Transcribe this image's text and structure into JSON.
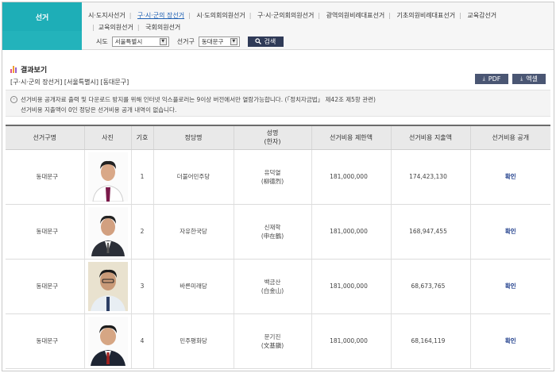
{
  "sidebar": {
    "label": "선거"
  },
  "tabs": [
    {
      "label": "시·도지사선거",
      "active": false
    },
    {
      "label": "구·시·군의 장선거",
      "active": true
    },
    {
      "label": "시·도의회의원선거",
      "active": false
    },
    {
      "label": "구·시·군의회의원선거",
      "active": false
    },
    {
      "label": "광역의원비례대표선거",
      "active": false
    },
    {
      "label": "기초의원비례대표선거",
      "active": false
    },
    {
      "label": "교육감선거",
      "active": false
    },
    {
      "label": "교육의원선거",
      "active": false
    },
    {
      "label": "국회의원선거",
      "active": false
    }
  ],
  "filter": {
    "sido_label": "시도",
    "sido_value": "서울특별시",
    "district_label": "선거구",
    "district_value": "동대문구",
    "search_label": "검색"
  },
  "result": {
    "title": "결과보기",
    "breadcrumb": "[구·시·군의 장선거] [서울특별시] [동대문구]",
    "pdf_label": "PDF",
    "excel_label": "엑셀",
    "notice_line1": "선거비용 공개자료 출력 및 다운로드 방지를 위해 인터넷 익스플로러는 9이상 버전에서만 열람가능합니다. (「정치자금법」 제42조 제5항 관련)",
    "notice_line2": "선거비용 지출액이 0인 정당은 선거비용 공개 내역이 없습니다."
  },
  "table": {
    "headers": {
      "area": "선거구명",
      "photo": "사진",
      "number": "기호",
      "party": "정당명",
      "name_1": "성명",
      "name_2": "(한자)",
      "limit": "선거비용 제한액",
      "spent": "선거비용 지출액",
      "open": "선거비용 공개"
    },
    "rows": [
      {
        "area": "동대문구",
        "number": "1",
        "party": "더불어민주당",
        "name": "유덕열",
        "hanja": "(柳德烈)",
        "limit": "181,000,000",
        "spent": "174,423,130",
        "link": "확인"
      },
      {
        "area": "동대문구",
        "number": "2",
        "party": "자유한국당",
        "name": "신재학",
        "hanja": "(申在鶴)",
        "limit": "181,000,000",
        "spent": "168,947,455",
        "link": "확인"
      },
      {
        "area": "동대문구",
        "number": "3",
        "party": "바른미래당",
        "name": "백금산",
        "hanja": "(白金山)",
        "limit": "181,000,000",
        "spent": "68,673,765",
        "link": "확인"
      },
      {
        "area": "동대문구",
        "number": "4",
        "party": "민주평화당",
        "name": "문기진",
        "hanja": "(文基鎭)",
        "limit": "181,000,000",
        "spent": "68,164,119",
        "link": "확인"
      }
    ]
  },
  "colors": {
    "accent": "#1eaeb7",
    "tab_active": "#1d5fb2",
    "search_button": "#2f3a57",
    "download_button": "#4a5673",
    "icon_bars": [
      "#e0508a",
      "#f0a030",
      "#9a60c8"
    ]
  },
  "icons": {
    "chart": "bar-chart-icon",
    "search": "magnifier-icon",
    "download": "download-icon",
    "notice": "info-circle-icon"
  }
}
